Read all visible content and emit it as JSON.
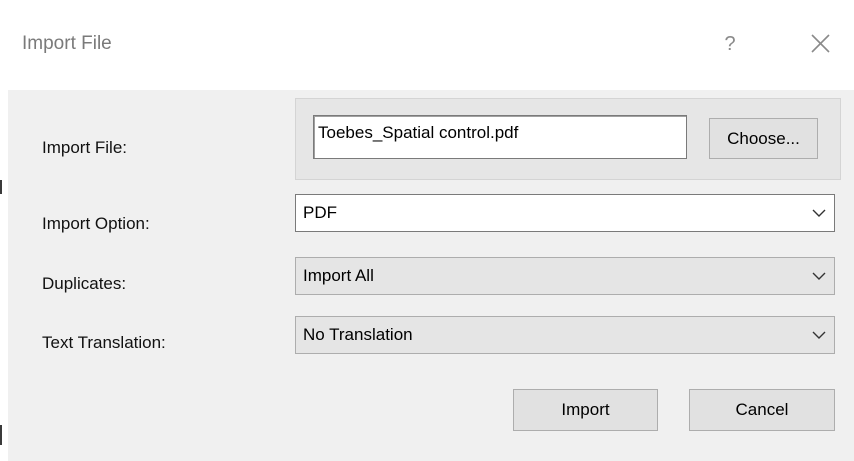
{
  "window": {
    "title": "Import File",
    "help_glyph": "?",
    "close_icon": "close-icon"
  },
  "form": {
    "import_file_label": "Import File:",
    "import_file_value": "Toebes_Spatial control.pdf",
    "choose_label": "Choose...",
    "import_option_label": "Import Option:",
    "import_option_value": "PDF",
    "duplicates_label": "Duplicates:",
    "duplicates_value": "Import All",
    "text_translation_label": "Text Translation:",
    "text_translation_value": "No Translation"
  },
  "actions": {
    "import_label": "Import",
    "cancel_label": "Cancel"
  },
  "icons": {
    "dropdown": "chevron-down-icon"
  }
}
